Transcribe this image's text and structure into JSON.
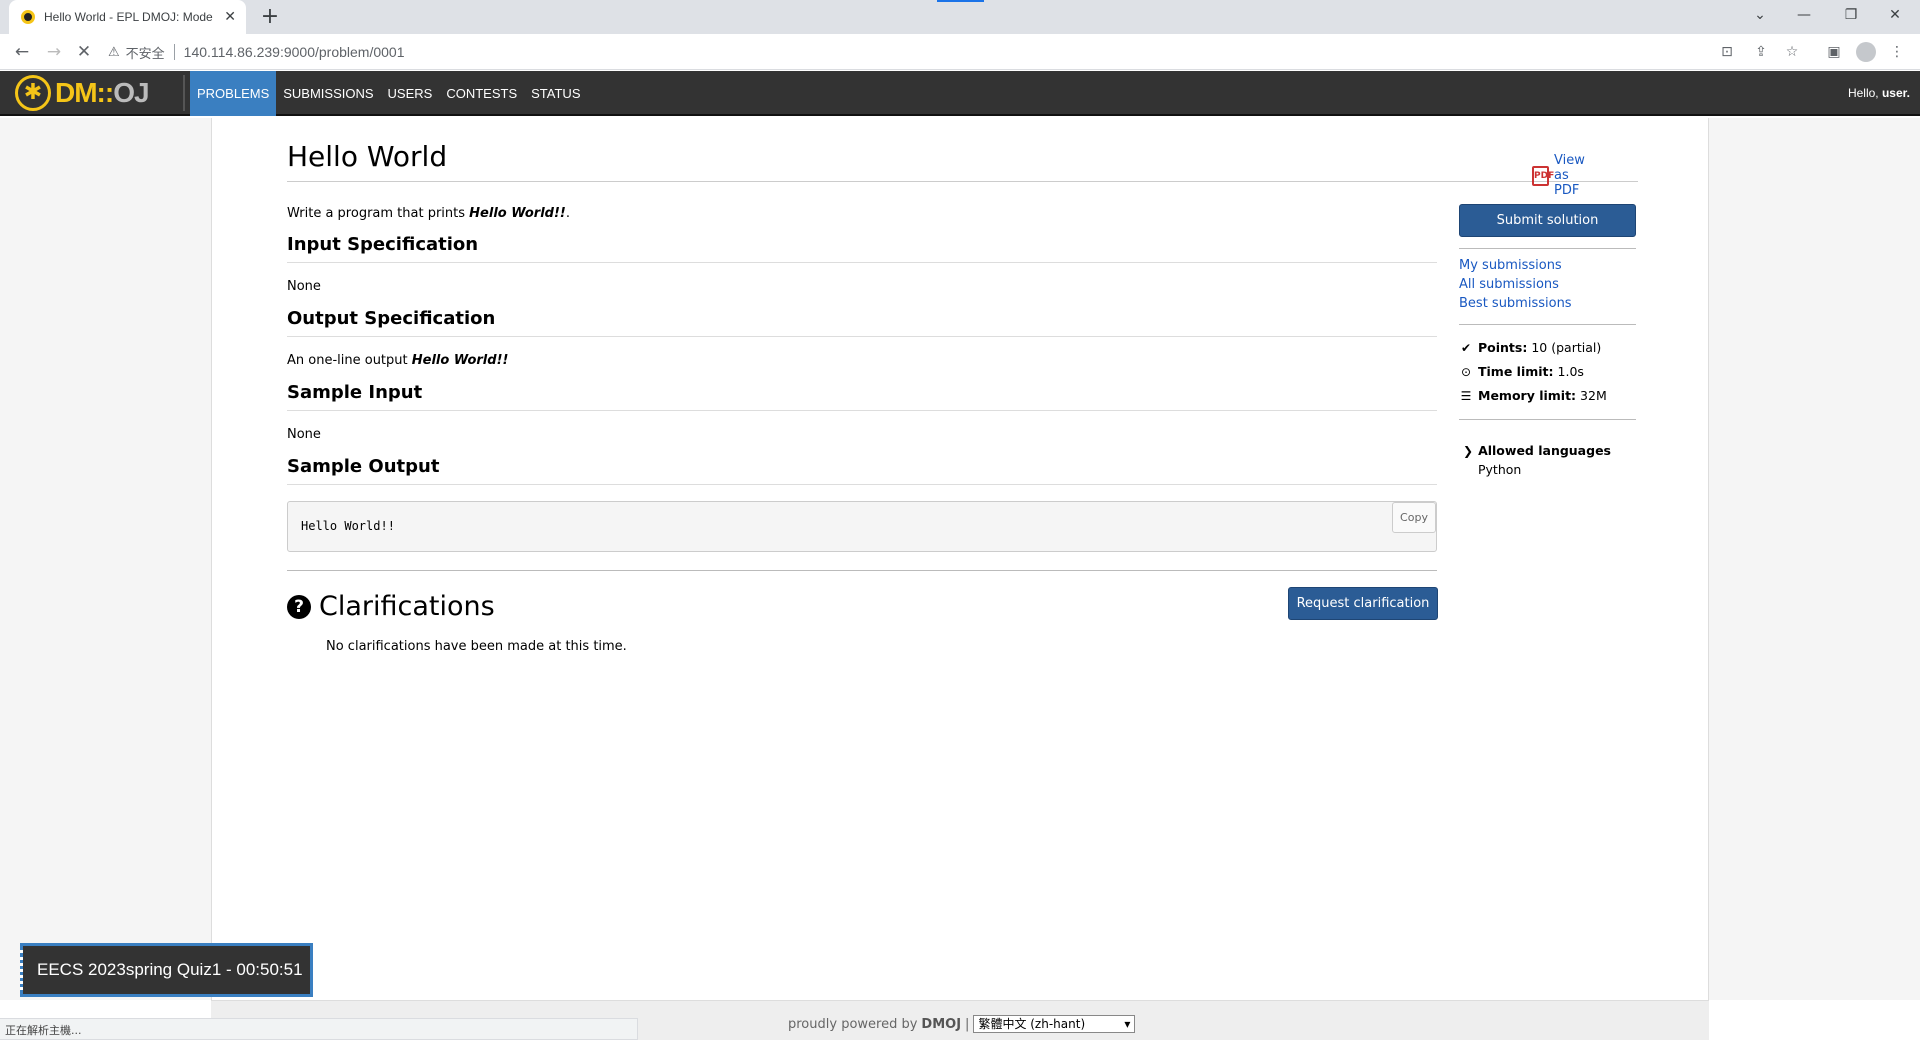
{
  "browser": {
    "tab_title": "Hello World - EPL DMOJ: Mode",
    "tab_close": "✕",
    "new_tab": "+",
    "insecure_label": "不安全",
    "url": "140.114.86.239:9000/problem/0001",
    "status_text": "正在解析主機..."
  },
  "nav": {
    "logo_text": "DM::",
    "logo_oj": "OJ",
    "items": [
      {
        "label": "PROBLEMS"
      },
      {
        "label": "SUBMISSIONS"
      },
      {
        "label": "USERS"
      },
      {
        "label": "CONTESTS"
      },
      {
        "label": "STATUS"
      }
    ],
    "hello_prefix": "Hello,",
    "hello_user": "user."
  },
  "problem": {
    "title": "Hello World",
    "pdf_link": "View as PDF",
    "desc_prefix": "Write a program that prints ",
    "desc_bold": "Hello World!!",
    "desc_suffix": ".",
    "sections": {
      "input_heading": "Input Specification",
      "input_text": "None",
      "output_heading": "Output Specification",
      "output_prefix": "An one-line output ",
      "output_bold": "Hello World!!",
      "sample_input_heading": "Sample Input",
      "sample_input_text": "None",
      "sample_output_heading": "Sample Output",
      "sample_output_code": "Hello World!!",
      "copy_label": "Copy"
    },
    "clarifications": {
      "heading": "Clarifications",
      "request_button": "Request clarification",
      "empty_text": "No clarifications have been made at this time."
    }
  },
  "sidebar": {
    "submit_button": "Submit solution",
    "links": [
      "My submissions",
      "All submissions",
      "Best submissions"
    ],
    "points_label": "Points:",
    "points_value": "10 (partial)",
    "time_label": "Time limit:",
    "time_value": "1.0s",
    "memory_label": "Memory limit:",
    "memory_value": "32M",
    "languages_label": "Allowed languages",
    "languages_value": "Python"
  },
  "footer": {
    "powered_by": "proudly powered by",
    "brand": "DMOJ",
    "separator": "|",
    "language_select": "繁體中文 (zh-hant)"
  },
  "timer": {
    "text": "EECS 2023spring Quiz1 - 00:50:51"
  },
  "colors": {
    "nav_bg": "#333333",
    "nav_active": "#3a7fc1",
    "button_blue": "#2b5c95",
    "link_blue": "#1958c1",
    "logo_yellow": "#f5c518"
  }
}
